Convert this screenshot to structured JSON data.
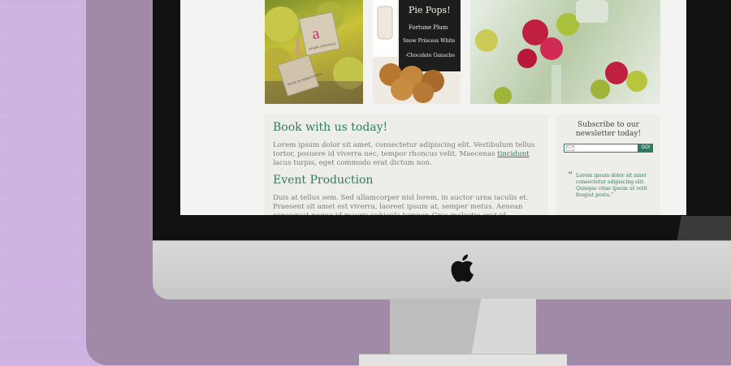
{
  "colors": {
    "wall": "#cdb2e2",
    "accent": "#2f7a63",
    "body_text": "#7b7b7b"
  },
  "photos": {
    "pears_tag_big": "a",
    "pears_tag_small": "simple ceremony",
    "pears_tag_small2": "florist by appointment",
    "pie_sign": [
      "Pie Pops!",
      "Fortune Plum",
      "Snow Princess White",
      "-Chocolate Ganache"
    ]
  },
  "main": {
    "heading1": "Book with us today!",
    "para1_before": "Lorem ipsum dolor sit amet, consectetur adipiscing elit. Vestibulum tellus tortor, posuere id viverra nec, tempor rhoncus velit. Maecenas ",
    "para1_link": "tincidunt",
    "para1_after": " lacus turpis, eget commodo erat dictum non.",
    "heading2": "Event Production",
    "para2": "Duis at tellus sem. Sed ullamcorper nisl lorem, in auctor urna iaculis et. Praesent sit amet est viverra, laoreet ipsum at, semper metus. Aenean consequat neque id mauris vehicula tempor. Cras molestie erat id tincidunt."
  },
  "sidebar": {
    "newsletter_title": "Subscribe to our newsletter today!",
    "newsletter_button": "GO!",
    "newsletter_icon": "envelope-icon",
    "quote_mark": "“",
    "quote": "Lorem ipsum dolor sit amet consectetur adipiscing elit. Quisque vitae ipsum ut velit feugiat posta.”"
  },
  "device": {
    "logo_icon": "apple-logo-icon"
  }
}
